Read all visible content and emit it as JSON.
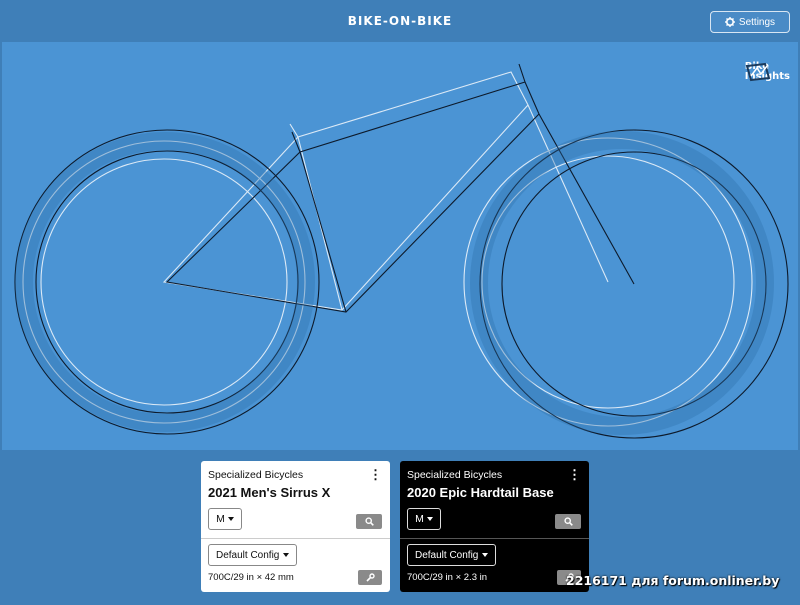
{
  "header": {
    "title": "BIKE-ON-BIKE",
    "settings_label": "Settings"
  },
  "logo": {
    "line1": "Bike",
    "line2": "Insights"
  },
  "colors": {
    "canvas_bg": "#4b94d4",
    "chrome_bg": "#3f7fb8",
    "bike_a_stroke": "#dbe9f6",
    "bike_b_stroke": "#0d1a2b"
  },
  "bikes": [
    {
      "brand": "Specialized Bicycles",
      "model": "2021 Men's Sirrus X",
      "size": "M",
      "config": "Default Config",
      "tire": "700C/29 in × 42 mm",
      "theme": "light"
    },
    {
      "brand": "Specialized Bicycles",
      "model": "2020 Epic Hardtail Base",
      "size": "M",
      "config": "Default Config",
      "tire": "700C/29 in × 2.3 in",
      "theme": "dark"
    }
  ],
  "icons": {
    "settings": "gear-icon",
    "menu": "kebab-icon",
    "search": "search-icon",
    "edit": "wrench-icon",
    "dropdown": "caret-down-icon"
  },
  "watermark": "2216171 для forum.onliner.by"
}
